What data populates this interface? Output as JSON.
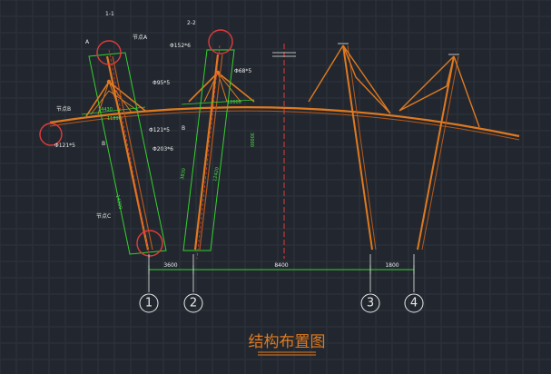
{
  "labels": {
    "a": "A",
    "b": "B",
    "sec_1_top": "1-1",
    "sec_2_top": "2-2",
    "node_a_top": "节点A",
    "node_b": "节点B",
    "node_c": "节点C",
    "pipe_152": "Φ152*6",
    "pipe_95": "Φ95*5",
    "pipe_68": "Φ68*5",
    "pipe_121": "Φ121*5",
    "pipe_121b": "Φ121*5",
    "pipe_203": "Φ203*6",
    "dim_left_top": "14430",
    "dim_left_mid": "11890",
    "dim_right_top": "12000",
    "dim_col1": "14300",
    "dim_col2": "12420",
    "dim_vert": "30000",
    "dim_small": "3830"
  },
  "dimensions": {
    "span_1_2": "3600",
    "span_2_3": "8400",
    "span_3_4": "1800"
  },
  "axes": [
    "1",
    "2",
    "3",
    "4"
  ],
  "title": "结构布置图",
  "colors": {
    "background": "#22272f",
    "member": "#e07a1f",
    "outline": "#35d12e",
    "highlight": "#e23b3b",
    "annotation": "#e8e8e8"
  }
}
